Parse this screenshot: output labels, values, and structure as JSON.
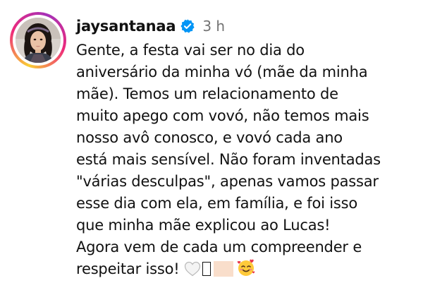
{
  "comment": {
    "username": "jaysantanaa",
    "verified_icon": "verified-badge-icon",
    "timestamp": "3 h",
    "text_lines": [
      "Gente, a festa vai ser no dia do",
      "aniversário da minha vó (mãe da minha",
      "mãe). Temos um relacionamento de",
      "muito apego com vovó, não temos mais",
      "nosso avô conosco, e vovó cada ano",
      "está mais sensível. Não foram inventadas",
      "\"várias desculpas\", apenas vamos passar",
      "esse dia com ela, em família, e foi isso",
      "que minha mãe explicou ao Lucas!",
      "Agora vem de cada um compreender e",
      "respeitar isso!"
    ],
    "emojis": [
      "white-heart-emoji",
      "unsupported-glyph-box",
      "skin-tone-swatch",
      "smiling-face-with-hearts-emoji"
    ]
  },
  "colors": {
    "text": "#111111",
    "timestamp": "#737373",
    "verified_blue": "#0095f6",
    "story_ring_start": "#f9ce34",
    "story_ring_mid": "#ee2a7b",
    "story_ring_end": "#a431b8"
  }
}
